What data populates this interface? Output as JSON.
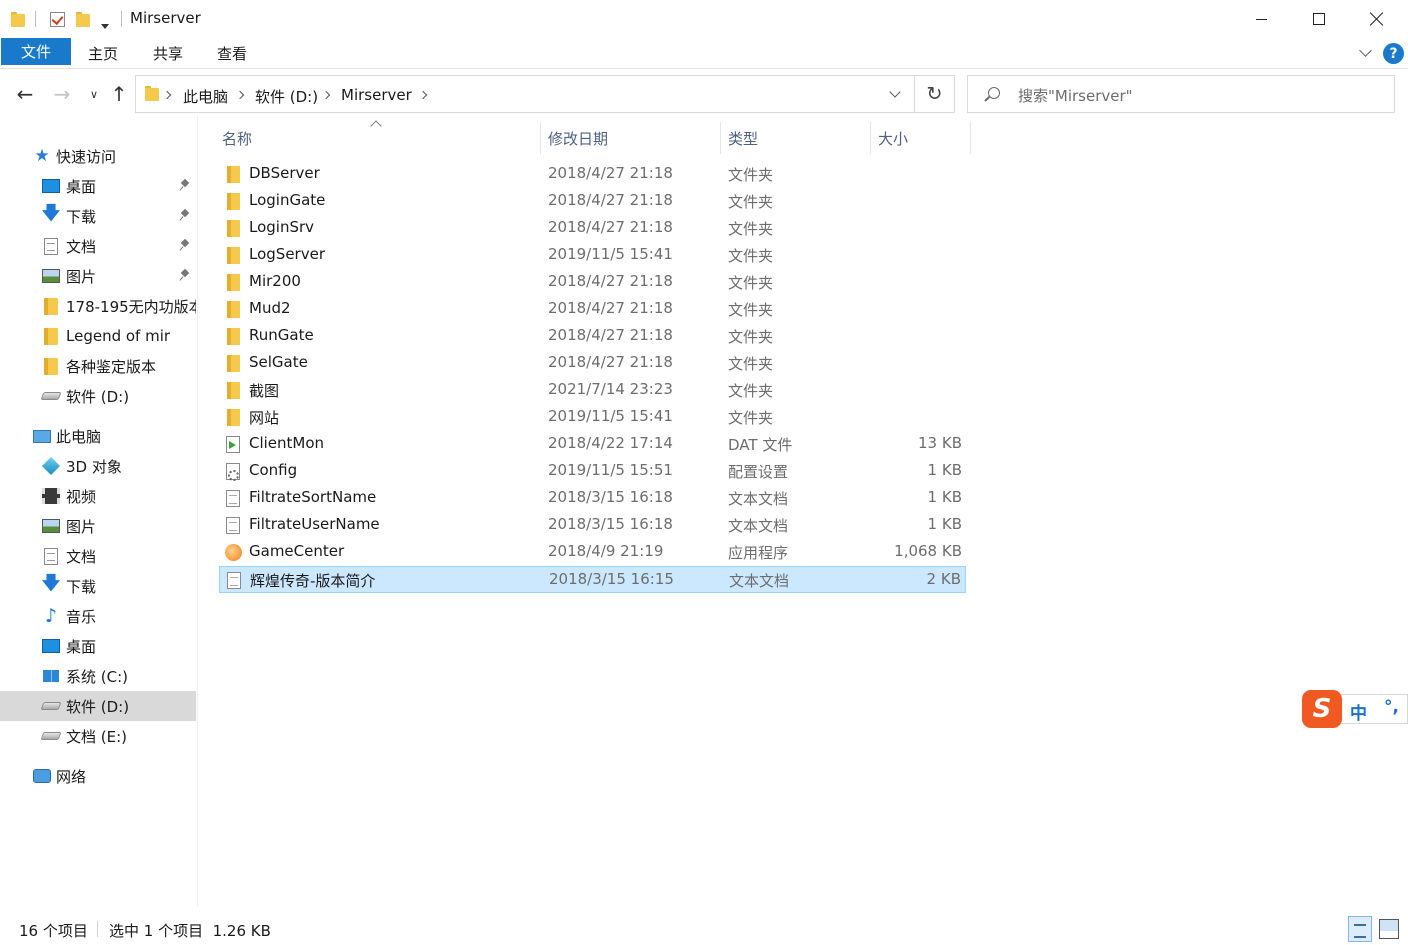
{
  "window": {
    "title": "Mirserver"
  },
  "ribbon": {
    "file_tab": "文件",
    "tabs": [
      "主页",
      "共享",
      "查看"
    ],
    "help": "?"
  },
  "address": {
    "crumbs": [
      "此电脑",
      "软件 (D:)",
      "Mirserver"
    ],
    "search_placeholder": "搜索\"Mirserver\""
  },
  "sidebar": {
    "quick_access": "快速访问",
    "quick_items": [
      {
        "label": "桌面",
        "icon": "desktop-icon",
        "pinned": true
      },
      {
        "label": "下载",
        "icon": "download-icon",
        "pinned": true
      },
      {
        "label": "文档",
        "icon": "document-icon",
        "pinned": true
      },
      {
        "label": "图片",
        "icon": "picture-icon",
        "pinned": true
      },
      {
        "label": "178-195无内功版本",
        "icon": "folder-icon",
        "pinned": false
      },
      {
        "label": "Legend of mir",
        "icon": "folder-icon",
        "pinned": false
      },
      {
        "label": "各种鉴定版本",
        "icon": "folder-icon",
        "pinned": false
      },
      {
        "label": "软件 (D:)",
        "icon": "drive-icon",
        "pinned": false
      }
    ],
    "this_pc": "此电脑",
    "pc_items": [
      {
        "label": "3D 对象",
        "icon": "3d-objects-icon"
      },
      {
        "label": "视频",
        "icon": "video-icon"
      },
      {
        "label": "图片",
        "icon": "picture-icon"
      },
      {
        "label": "文档",
        "icon": "document-icon"
      },
      {
        "label": "下载",
        "icon": "download-icon"
      },
      {
        "label": "音乐",
        "icon": "music-icon"
      },
      {
        "label": "桌面",
        "icon": "desktop-icon"
      },
      {
        "label": "系统 (C:)",
        "icon": "windows-drive-icon"
      },
      {
        "label": "软件 (D:)",
        "icon": "drive-icon",
        "selected": true
      },
      {
        "label": "文档 (E:)",
        "icon": "drive-icon"
      }
    ],
    "network": "网络"
  },
  "columns": {
    "name": "名称",
    "date": "修改日期",
    "type": "类型",
    "size": "大小"
  },
  "files": [
    {
      "name": "DBServer",
      "date": "2018/4/27 21:18",
      "type": "文件夹",
      "size": "",
      "icon": "folder"
    },
    {
      "name": "LoginGate",
      "date": "2018/4/27 21:18",
      "type": "文件夹",
      "size": "",
      "icon": "folder"
    },
    {
      "name": "LoginSrv",
      "date": "2018/4/27 21:18",
      "type": "文件夹",
      "size": "",
      "icon": "folder"
    },
    {
      "name": "LogServer",
      "date": "2019/11/5 15:41",
      "type": "文件夹",
      "size": "",
      "icon": "folder"
    },
    {
      "name": "Mir200",
      "date": "2018/4/27 21:18",
      "type": "文件夹",
      "size": "",
      "icon": "folder"
    },
    {
      "name": "Mud2",
      "date": "2018/4/27 21:18",
      "type": "文件夹",
      "size": "",
      "icon": "folder"
    },
    {
      "name": "RunGate",
      "date": "2018/4/27 21:18",
      "type": "文件夹",
      "size": "",
      "icon": "folder"
    },
    {
      "name": "SelGate",
      "date": "2018/4/27 21:18",
      "type": "文件夹",
      "size": "",
      "icon": "folder"
    },
    {
      "name": "截图",
      "date": "2021/7/14 23:23",
      "type": "文件夹",
      "size": "",
      "icon": "folder"
    },
    {
      "name": "网站",
      "date": "2019/11/5 15:41",
      "type": "文件夹",
      "size": "",
      "icon": "folder"
    },
    {
      "name": "ClientMon",
      "date": "2018/4/22 17:14",
      "type": "DAT 文件",
      "size": "13 KB",
      "icon": "dat"
    },
    {
      "name": "Config",
      "date": "2019/11/5 15:51",
      "type": "配置设置",
      "size": "1 KB",
      "icon": "cfg"
    },
    {
      "name": "FiltrateSortName",
      "date": "2018/3/15 16:18",
      "type": "文本文档",
      "size": "1 KB",
      "icon": "doc"
    },
    {
      "name": "FiltrateUserName",
      "date": "2018/3/15 16:18",
      "type": "文本文档",
      "size": "1 KB",
      "icon": "doc"
    },
    {
      "name": "GameCenter",
      "date": "2018/4/9 21:19",
      "type": "应用程序",
      "size": "1,068 KB",
      "icon": "app"
    },
    {
      "name": "辉煌传奇-版本简介",
      "date": "2018/3/15 16:15",
      "type": "文本文档",
      "size": "2 KB",
      "icon": "doc",
      "selected": true
    }
  ],
  "status": {
    "count": "16 个项目",
    "selection": "选中 1 个项目  1.26 KB"
  },
  "ime": {
    "logo": "S",
    "mode": "中",
    "punct": "°,"
  },
  "colors": {
    "accent": "#1979ca",
    "selection": "#cce8ff",
    "folder": "#f4c94c"
  }
}
